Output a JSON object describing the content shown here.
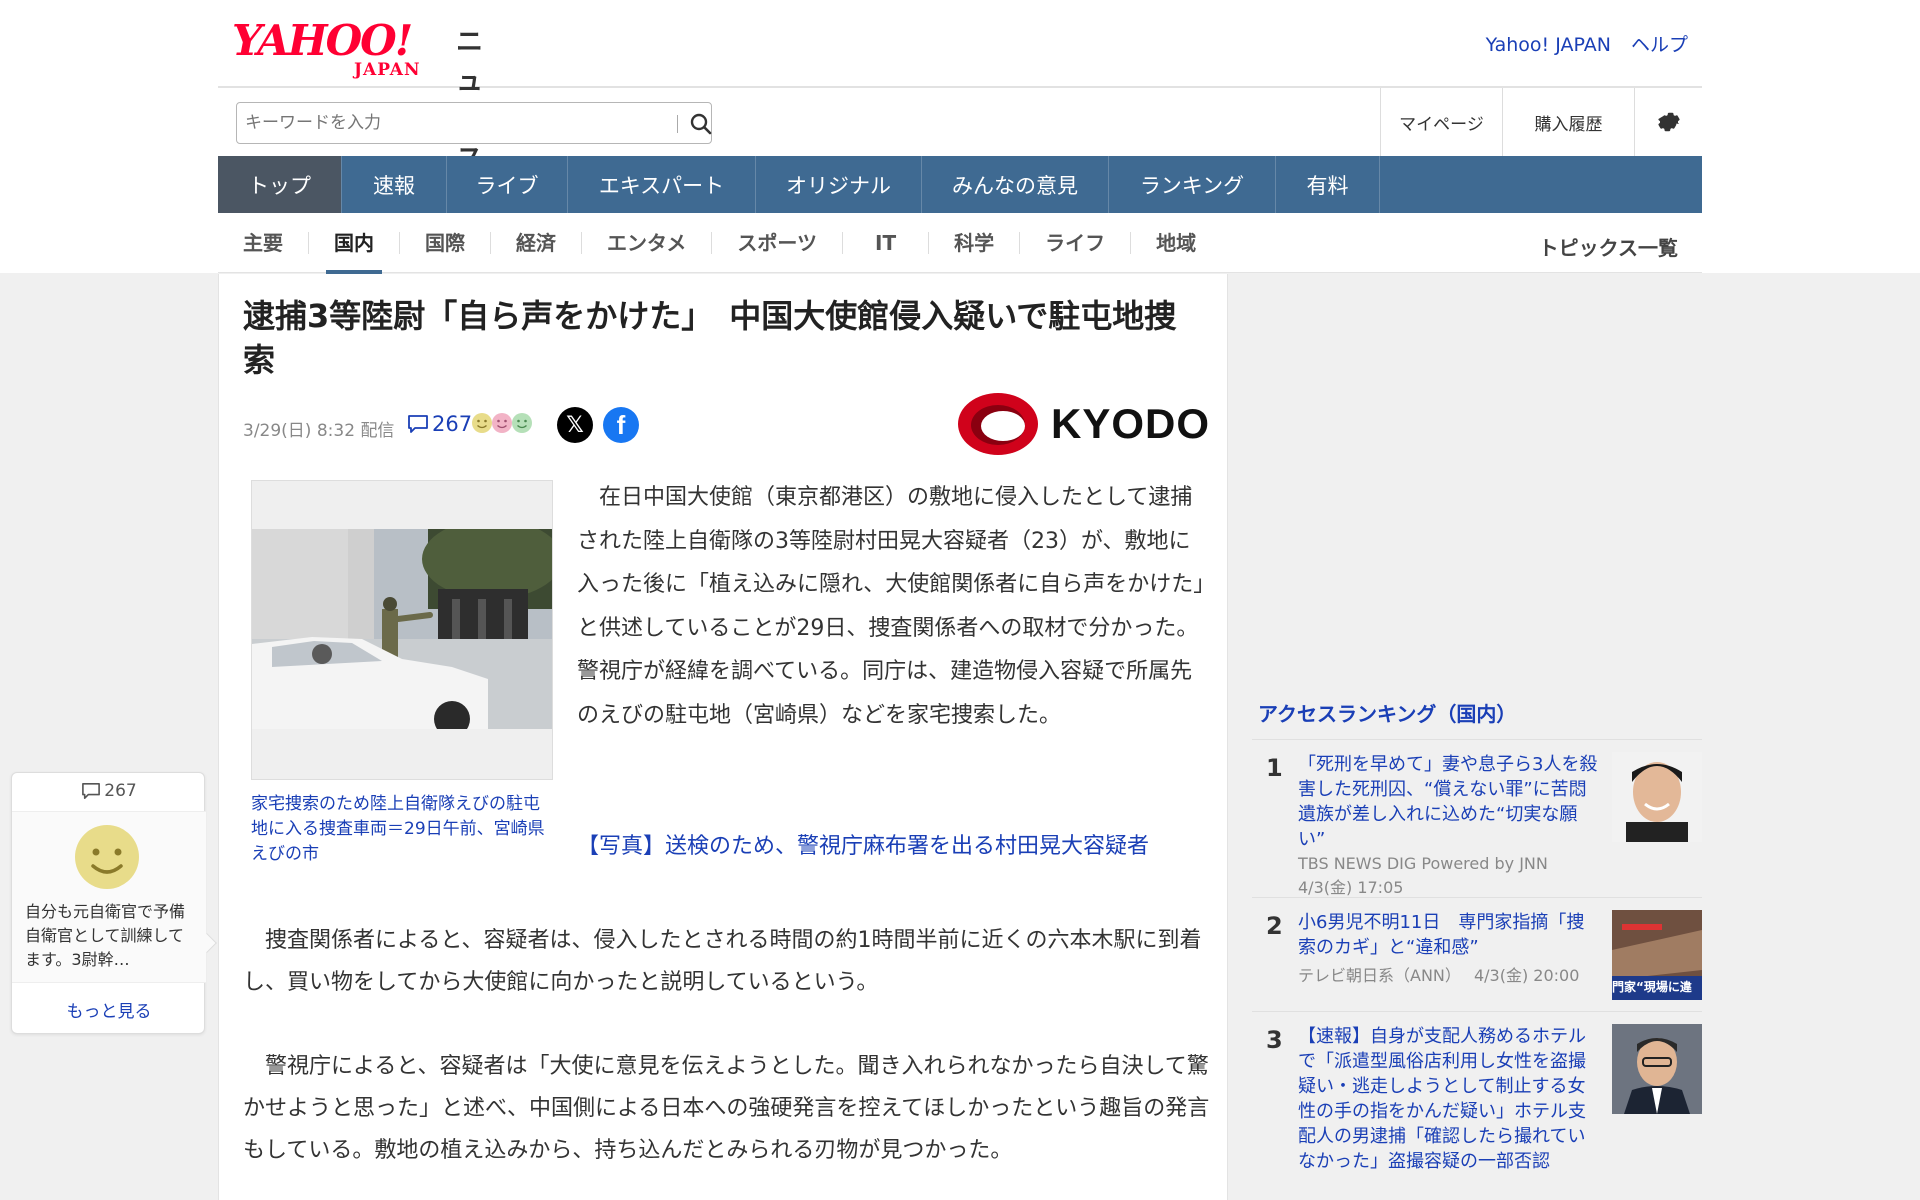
{
  "header": {
    "logo_main": "YAHOO!",
    "logo_japan": "JAPAN",
    "logo_news": "ニュース",
    "link_yahoo_japan": "Yahoo! JAPAN",
    "link_help": "ヘルプ"
  },
  "search": {
    "placeholder": "キーワードを入力",
    "mypage": "マイページ",
    "purchase_history": "購入履歴"
  },
  "nav": {
    "items": [
      "トップ",
      "速報",
      "ライブ",
      "エキスパート",
      "オリジナル",
      "みんなの意見",
      "ランキング",
      "有料"
    ],
    "active": "トップ"
  },
  "categories": {
    "items": [
      "主要",
      "国内",
      "国際",
      "経済",
      "エンタメ",
      "スポーツ",
      "IT",
      "科学",
      "ライフ",
      "地域"
    ],
    "active": "国内",
    "topics_link": "トピックス一覧"
  },
  "article": {
    "headline": "逮捕3等陸尉「自ら声をかけた」　中国大使館侵入疑いで駐屯地捜索",
    "date": "3/29(日) 8:32",
    "delivered": "配信",
    "comment_count": "267",
    "x_label": "𝕏",
    "fb_label": "f",
    "publisher": "KYODO",
    "photo_caption": "家宅捜索のため陸上自衛隊えびの駐屯地に入る捜査車両＝29日午前、宮崎県えびの市",
    "lead": "在日中国大使館（東京都港区）の敷地に侵入したとして逮捕された陸上自衛隊の3等陸尉村田晃大容疑者（23）が、敷地に入った後に「植え込みに隠れ、大使館関係者に自ら声をかけた」と供述していることが29日、捜査関係者への取材で分かった。警視庁が経緯を調べている。同庁は、建造物侵入容疑で所属先のえびの駐屯地（宮崎県）などを家宅捜索した。",
    "photo_link": "【写真】送検のため、警視庁麻布署を出る村田晃大容疑者",
    "para2": "捜査関係者によると、容疑者は、侵入したとされる時間の約1時間半前に近くの六本木駅に到着し、買い物をしてから大使館に向かったと説明しているという。",
    "para3": "警視庁によると、容疑者は「大使に意見を伝えようとした。聞き入れられなかったら自決して驚かせようと思った」と述べ、中国側による日本への強硬発言を控えてほしかったという趣旨の発言もしている。敷地の植え込みから、持ち込んだとみられる刃物が見つかった。"
  },
  "ranking": {
    "title": "アクセスランキング（国内）",
    "items": [
      {
        "rank": "1",
        "title": "「死刑を早めて」妻や息子ら3人を殺害した死刑囚、“償えない罪”に苦悶　遺族が差し入れに込めた“切実な願い”",
        "source": "TBS NEWS DIG Powered by JNN",
        "time": "4/3(金) 17:05"
      },
      {
        "rank": "2",
        "title": "小6男児不明11日　専門家指摘「捜索のカギ」と“違和感”",
        "source": "テレビ朝日系（ANN）",
        "time": "4/3(金) 20:00",
        "thumb_text": "門家“現場に違"
      },
      {
        "rank": "3",
        "title": "【速報】自身が支配人務めるホテルで「派遣型風俗店利用し女性を盗撮疑い・逃走しようとして制止する女性の手の指をかんだ疑い」ホテル支配人の男逮捕「確認したら撮れていなかった」盗撮容疑の一部否認"
      }
    ]
  },
  "float_card": {
    "comment_count": "267",
    "excerpt": "自分も元自衛官で予備自衛官として訓練してます。3尉幹…",
    "more": "もっと見る"
  },
  "colors": {
    "nav_bg": "#3f6a92",
    "nav_active": "#4b5663",
    "link": "#1a3fb6",
    "yahoo_red": "#ff0033"
  }
}
